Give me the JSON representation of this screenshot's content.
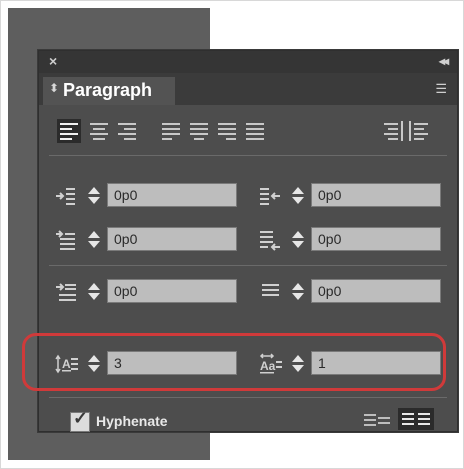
{
  "panel": {
    "close_glyph": "×",
    "collapse_glyph": "◂◂",
    "tab_arrows": "⬍",
    "title": "Paragraph",
    "menu_glyph": "☰"
  },
  "alignment": {
    "buttons": [
      {
        "name": "align-left",
        "selected": true
      },
      {
        "name": "align-center",
        "selected": false
      },
      {
        "name": "align-right",
        "selected": false
      },
      {
        "name": "justify-left",
        "selected": false
      },
      {
        "name": "justify-center",
        "selected": false
      },
      {
        "name": "justify-right",
        "selected": false
      },
      {
        "name": "justify-all",
        "selected": false
      },
      {
        "name": "align-towards-spine",
        "selected": false
      },
      {
        "name": "align-away-from-spine",
        "selected": false
      }
    ]
  },
  "fields": {
    "left_indent": "0p0",
    "right_indent": "0p0",
    "first_line_indent": "0p0",
    "last_line_right_indent": "0p0",
    "space_before": "0p0",
    "space_after": "0p0",
    "drop_cap_lines": "3",
    "drop_cap_chars": "1"
  },
  "hyphenate": {
    "checked": true,
    "label": "Hyphenate"
  },
  "colors": {
    "highlight": "#d03a3a",
    "panel_bg": "#4d4d4d",
    "field_bg": "#bdbdbd"
  }
}
